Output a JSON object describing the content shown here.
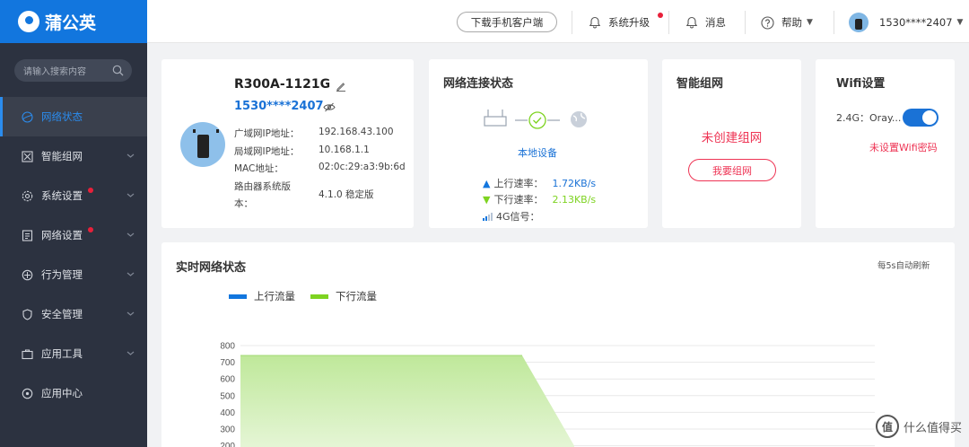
{
  "brand": {
    "name": "蒲公英"
  },
  "topbar": {
    "download": "下载手机客户端",
    "upgrade": "系统升级",
    "messages": "消息",
    "help": "帮助",
    "user": "1530****2407"
  },
  "sidebar": {
    "search_placeholder": "请输入搜索内容",
    "items": [
      {
        "label": "网络状态",
        "active": true
      },
      {
        "label": "智能组网"
      },
      {
        "label": "系统设置",
        "badge": true
      },
      {
        "label": "网络设置",
        "badge": true
      },
      {
        "label": "行为管理"
      },
      {
        "label": "安全管理"
      },
      {
        "label": "应用工具"
      },
      {
        "label": "应用中心"
      }
    ]
  },
  "device": {
    "name": "R300A-1121G",
    "phone": "1530****2407",
    "rows": [
      {
        "label": "广域网IP地址：",
        "value": "192.168.43.100"
      },
      {
        "label": "局域网IP地址：",
        "value": "10.168.1.1"
      },
      {
        "label": "MAC地址：",
        "value": "02:0c:29:a3:9b:6d"
      },
      {
        "label": "路由器系统版",
        "label2": "本：",
        "value": "4.1.0 稳定版"
      }
    ]
  },
  "connection": {
    "title": "网络连接状态",
    "local": "本地设备",
    "up_label": "上行速率：",
    "up_value": "1.72KB/s",
    "down_label": "下行速率：",
    "down_value": "2.13KB/s",
    "signal_label": "4G信号："
  },
  "mesh": {
    "title": "智能组网",
    "status": "未创建组网",
    "button": "我要组网"
  },
  "wifi": {
    "title": "Wifi设置",
    "band_label": "2.4G：Oray...",
    "enabled": true,
    "warning": "未设置Wifi密码"
  },
  "realtime": {
    "title": "实时网络状态",
    "refresh": "每5s自动刷新"
  },
  "chart_data": {
    "type": "area",
    "series": [
      {
        "name": "上行流量",
        "color": "#1276de",
        "values": []
      },
      {
        "name": "下行流量",
        "color": "#7ed321",
        "values": [
          740,
          740,
          740,
          740,
          740,
          740,
          200
        ]
      }
    ],
    "yticks": [
      "800",
      "700",
      "600",
      "500",
      "400",
      "300",
      "200"
    ],
    "ylim": [
      200,
      800
    ],
    "grid": true,
    "legend": "top-left"
  },
  "colors": {
    "accent": "#1276de",
    "sidebar": "#2c3240",
    "danger": "#ee3454",
    "download": "#7ed321"
  },
  "watermark": {
    "text": "值 什么值得买"
  }
}
